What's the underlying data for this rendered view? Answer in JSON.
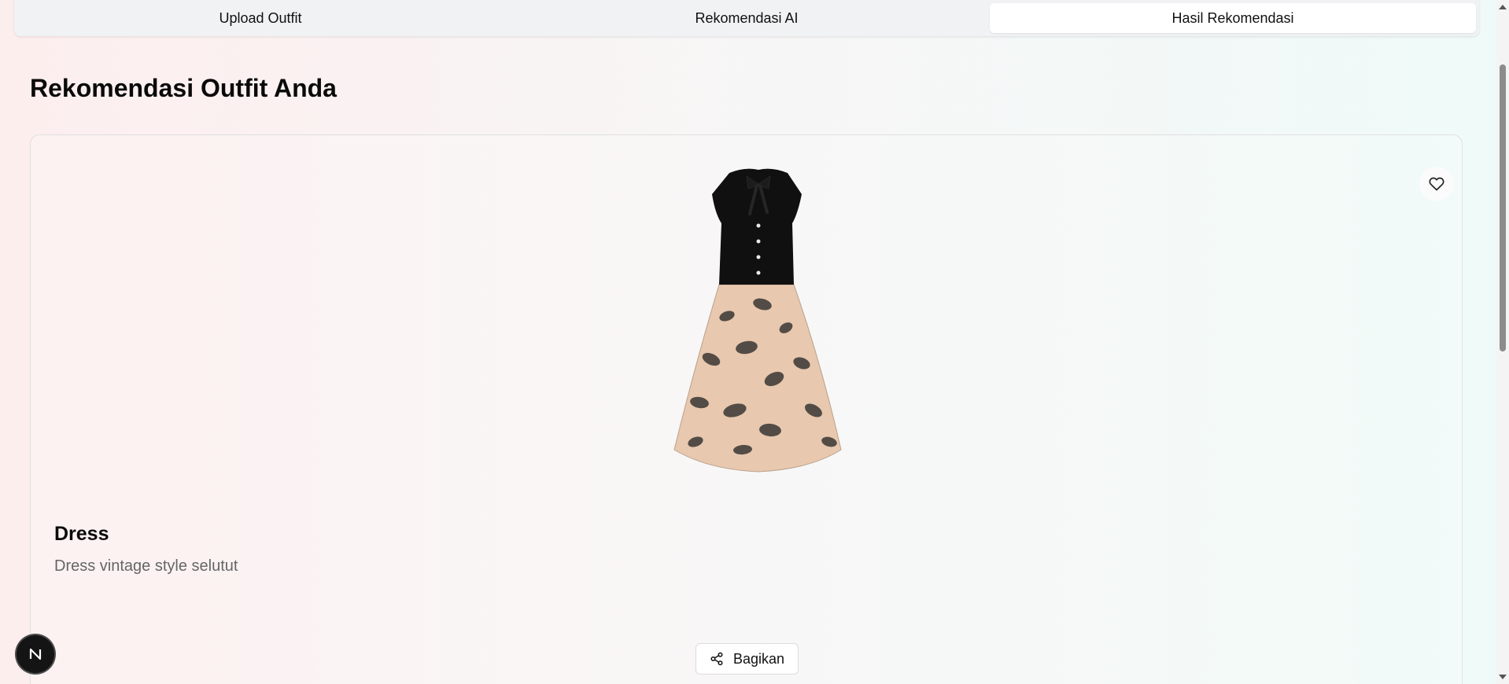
{
  "tabs": [
    {
      "label": "Upload Outfit",
      "active": false
    },
    {
      "label": "Rekomendasi AI",
      "active": false
    },
    {
      "label": "Hasil Rekomendasi",
      "active": true
    }
  ],
  "page": {
    "title": "Rekomendasi Outfit Anda"
  },
  "recommendation": {
    "name": "Dress",
    "description": "Dress vintage style selutut",
    "image_icon": "dress-image",
    "favorite_icon": "heart-icon"
  },
  "share": {
    "label": "Bagikan",
    "icon": "share-icon"
  },
  "badge": {
    "letter": "N"
  },
  "colors": {
    "accent_dark": "#141414",
    "bodice": "#101010",
    "skirt": "#e8c8ae"
  }
}
